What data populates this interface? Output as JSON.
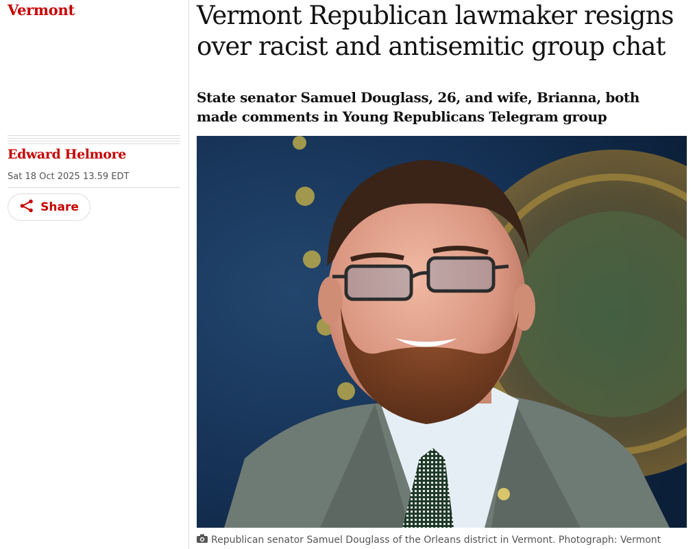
{
  "section": {
    "label": "Vermont"
  },
  "byline": {
    "author": "Edward Helmore",
    "date": "Sat 18 Oct 2025 13.59 EDT"
  },
  "share": {
    "label": "Share",
    "icon": "share-icon"
  },
  "article": {
    "headline": "Vermont Republican lawmaker resigns over racist and antisemitic group chat",
    "standfirst": "State senator Samuel Douglass, 26, and wife, Brianna, both made comments in Young Republicans Telegram group"
  },
  "image": {
    "caption": "Republican senator Samuel Douglass of the Orleans district in Vermont. Photograph: Vermont",
    "caption_icon": "camera-icon"
  },
  "colors": {
    "accent": "#c70000",
    "text": "#121212",
    "muted": "#545454",
    "divider": "#dcdcdc"
  }
}
